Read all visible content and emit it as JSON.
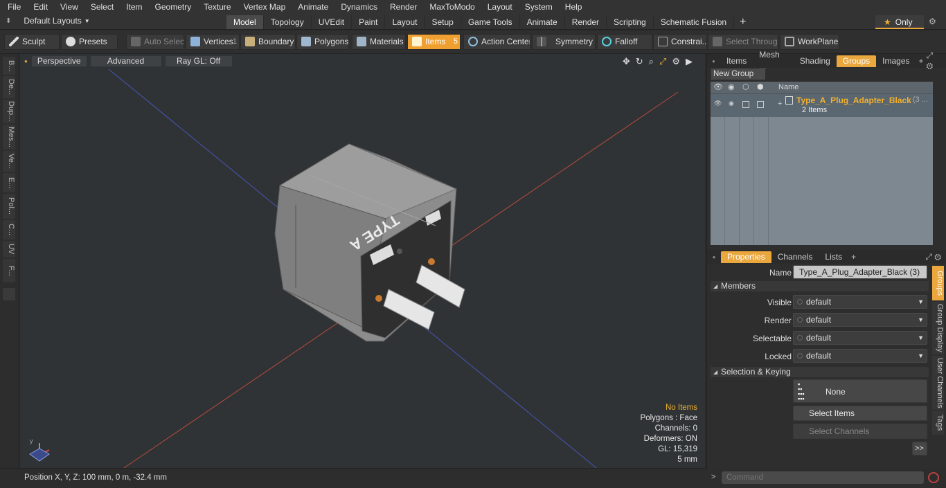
{
  "menu": [
    "File",
    "Edit",
    "View",
    "Select",
    "Item",
    "Geometry",
    "Texture",
    "Vertex Map",
    "Animate",
    "Dynamics",
    "Render",
    "MaxToModo",
    "Layout",
    "System",
    "Help"
  ],
  "layouts_label": "Default Layouts",
  "tabs": [
    "Model",
    "Topology",
    "UVEdit",
    "Paint",
    "Layout",
    "Setup",
    "Game Tools",
    "Animate",
    "Render",
    "Scripting",
    "Schematic Fusion"
  ],
  "only_label": "Only",
  "toolbar": {
    "sculpt": "Sculpt",
    "presets": "Presets",
    "auto_select": "Auto Select",
    "vertices": "Vertices",
    "vertices_count": "1",
    "boundary": "Boundary",
    "polygons": "Polygons",
    "materials": "Materials",
    "items": "Items",
    "items_count": "5",
    "action_center": "Action Center",
    "symmetry": "Symmetry",
    "falloff": "Falloff",
    "constrain": "Constrai...",
    "select_through": "Select Through",
    "workplane": "WorkPlane"
  },
  "left_tabs": [
    "B...",
    "De...",
    "Dup...",
    "Mes...",
    "Ve...",
    "E...",
    "Pol...",
    "C...",
    "UV",
    "F..."
  ],
  "viewport": {
    "perspective": "Perspective",
    "advanced": "Advanced",
    "raygl": "Ray GL: Off",
    "model_label": "TYPE A",
    "stats": {
      "items": "No Items",
      "polygons": "Polygons : Face",
      "channels": "Channels: 0",
      "deformers": "Deformers: ON",
      "gl": "GL: 15,319",
      "scale": "5 mm"
    }
  },
  "status": {
    "position": "Position X, Y, Z:  100 mm, 0 m, -32.4 mm"
  },
  "panel_tabs": [
    "Items",
    "Mesh ...",
    "Shading",
    "Groups",
    "Images"
  ],
  "new_group": "New Group",
  "group_header": "Name",
  "group": {
    "name": "Type_A_Plug_Adapter_Black",
    "suffix": "(3 ...",
    "count": "2 Items"
  },
  "props_tabs": [
    "Properties",
    "Channels",
    "Lists"
  ],
  "props": {
    "name_label": "Name",
    "name_value": "Type_A_Plug_Adapter_Black (3)",
    "members": "Members",
    "visible_label": "Visible",
    "render_label": "Render",
    "selectable_label": "Selectable",
    "locked_label": "Locked",
    "default_value": "default",
    "sel_keying": "Selection & Keying",
    "none": "None",
    "select_items": "Select Items",
    "select_channels": "Select Channels",
    "more": ">>"
  },
  "side_tabs": [
    "Groups",
    "Group Display",
    "User Channels",
    "Tags"
  ],
  "command_placeholder": "Command"
}
